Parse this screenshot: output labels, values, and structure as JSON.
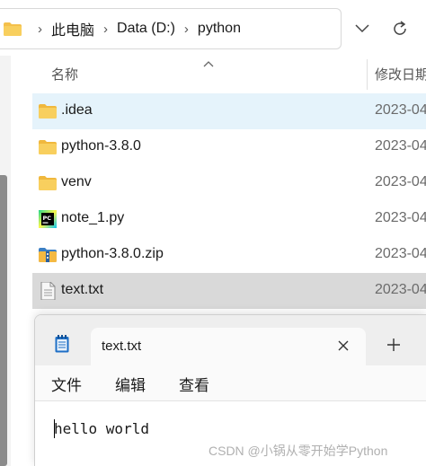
{
  "explorer": {
    "breadcrumb": [
      "此电脑",
      "Data (D:)",
      "python"
    ],
    "columns": {
      "name": "名称",
      "date": "修改日期"
    },
    "files": [
      {
        "name": ".idea",
        "date": "2023-04",
        "icon": "folder-icon",
        "state": "hover"
      },
      {
        "name": "python-3.8.0",
        "date": "2023-04",
        "icon": "folder-icon",
        "state": "normal"
      },
      {
        "name": "venv",
        "date": "2023-04",
        "icon": "folder-icon",
        "state": "normal"
      },
      {
        "name": "note_1.py",
        "date": "2023-04",
        "icon": "pycharm-file-icon",
        "state": "normal"
      },
      {
        "name": "python-3.8.0.zip",
        "date": "2023-04",
        "icon": "zip-archive-icon",
        "state": "normal"
      },
      {
        "name": "text.txt",
        "date": "2023-04",
        "icon": "text-file-icon",
        "state": "selected"
      }
    ]
  },
  "notepad": {
    "tab_title": "text.txt",
    "menus": [
      "文件",
      "编辑",
      "查看"
    ],
    "content": "hello world"
  },
  "watermark": "CSDN @小锅从零开始学Python",
  "colors": {
    "hover_row": "#e5f3fb",
    "selected_row": "#d9d9d9",
    "folder": "#f4c04b"
  }
}
